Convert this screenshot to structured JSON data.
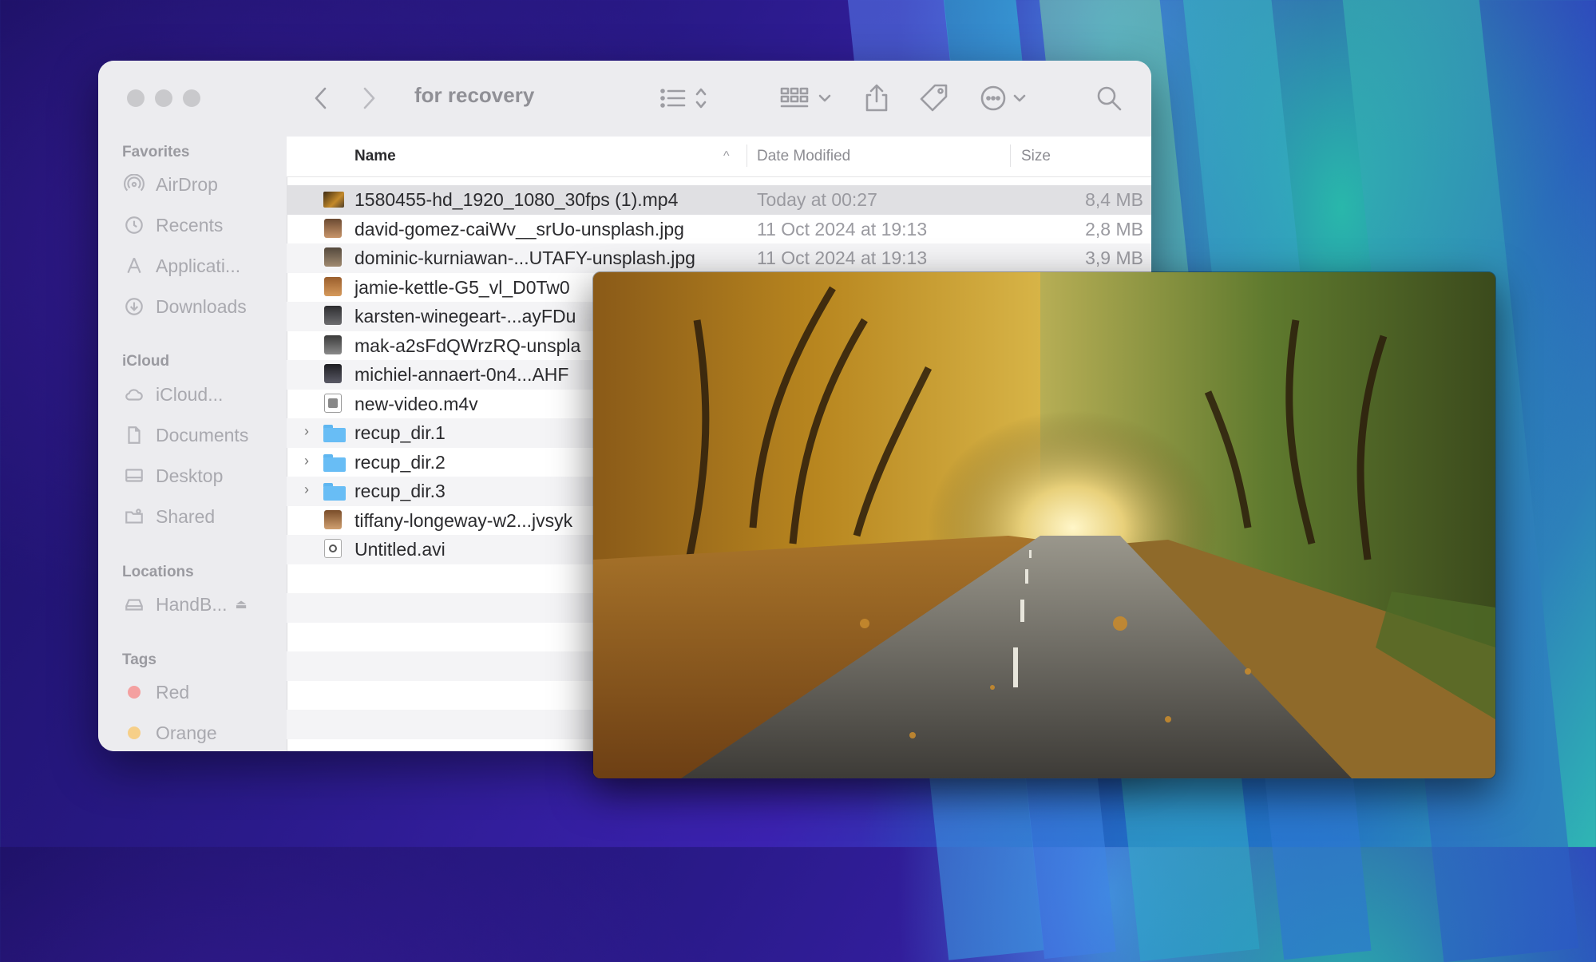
{
  "window": {
    "title": "for recovery"
  },
  "sidebar": {
    "favorites_label": "Favorites",
    "favorites": [
      {
        "label": "AirDrop",
        "icon": "airdrop-icon"
      },
      {
        "label": "Recents",
        "icon": "clock-icon"
      },
      {
        "label": "Applicati...",
        "icon": "applications-icon"
      },
      {
        "label": "Downloads",
        "icon": "download-icon"
      }
    ],
    "icloud_label": "iCloud",
    "icloud": [
      {
        "label": "iCloud...",
        "icon": "cloud-icon"
      },
      {
        "label": "Documents",
        "icon": "document-icon"
      },
      {
        "label": "Desktop",
        "icon": "desktop-icon"
      },
      {
        "label": "Shared",
        "icon": "shared-folder-icon"
      }
    ],
    "locations_label": "Locations",
    "locations": [
      {
        "label": "HandB...",
        "icon": "drive-icon"
      }
    ],
    "tags_label": "Tags",
    "tags": [
      {
        "label": "Red",
        "color": "#f28b8b"
      },
      {
        "label": "Orange",
        "color": "#f5c06a"
      }
    ]
  },
  "columns": {
    "name": "Name",
    "date": "Date Modified",
    "size": "Size"
  },
  "files": [
    {
      "name": "1580455-hd_1920_1080_30fps (1).mp4",
      "date": "Today at 00:27",
      "size": "8,4 MB",
      "kind": "video"
    },
    {
      "name": "david-gomez-caiWv__srUo-unsplash.jpg",
      "date": "11 Oct 2024 at 19:13",
      "size": "2,8 MB",
      "kind": "image"
    },
    {
      "name": "dominic-kurniawan-...UTAFY-unsplash.jpg",
      "date": "11 Oct 2024 at 19:13",
      "size": "3,9 MB",
      "kind": "image"
    },
    {
      "name": "jamie-kettle-G5_vl_D0Tw0",
      "date": "",
      "size": "",
      "kind": "image"
    },
    {
      "name": "karsten-winegeart-...ayFDu",
      "date": "",
      "size": "",
      "kind": "image"
    },
    {
      "name": "mak-a2sFdQWrzRQ-unspla",
      "date": "",
      "size": "",
      "kind": "image"
    },
    {
      "name": "michiel-annaert-0n4...AHF",
      "date": "",
      "size": "",
      "kind": "image"
    },
    {
      "name": "new-video.m4v",
      "date": "",
      "size": "",
      "kind": "video-file"
    },
    {
      "name": "recup_dir.1",
      "date": "",
      "size": "",
      "kind": "folder"
    },
    {
      "name": "recup_dir.2",
      "date": "",
      "size": "",
      "kind": "folder"
    },
    {
      "name": "recup_dir.3",
      "date": "",
      "size": "",
      "kind": "folder"
    },
    {
      "name": "tiffany-longeway-w2...jvsyk",
      "date": "",
      "size": "",
      "kind": "image"
    },
    {
      "name": "Untitled.avi",
      "date": "",
      "size": "",
      "kind": "avi"
    }
  ]
}
